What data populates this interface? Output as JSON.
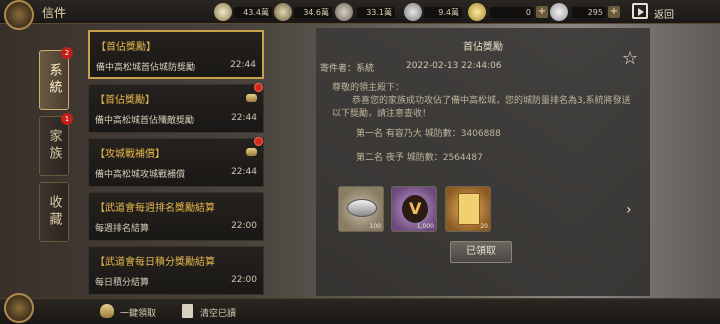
{
  "topbar": {
    "title": "信件",
    "resources": [
      {
        "icon": "gold-coin-icon",
        "value": "43.4萬"
      },
      {
        "icon": "wheat-icon",
        "value": "34.6萬"
      },
      {
        "icon": "wood-icon",
        "value": "33.1萬"
      },
      {
        "icon": "stone-icon",
        "value": "9.4萬"
      },
      {
        "icon": "jade-icon",
        "value": "0"
      },
      {
        "icon": "silver-icon",
        "value": "295"
      }
    ],
    "back_label": "返回"
  },
  "tabs": [
    {
      "label": "系統",
      "badge": "2",
      "active": true
    },
    {
      "label": "家族",
      "badge": "1",
      "active": false
    },
    {
      "label": "收藏",
      "badge": "",
      "active": false
    }
  ],
  "mails": [
    {
      "title": "【首佔獎勵】",
      "subtitle": "備中高松城首佔城防獎勵",
      "time": "22:44",
      "attachment": false,
      "unread": false,
      "selected": true
    },
    {
      "title": "【首佔獎勵】",
      "subtitle": "備中高松城首佔殲敵獎勵",
      "time": "22:44",
      "attachment": true,
      "unread": true,
      "selected": false
    },
    {
      "title": "【攻城戰補償】",
      "subtitle": "備中高松城攻城戰補償",
      "time": "22:44",
      "attachment": true,
      "unread": true,
      "selected": false
    },
    {
      "title": "【武道會每週排名獎勵結算",
      "subtitle": "每週排名結算",
      "time": "22:00",
      "attachment": false,
      "unread": false,
      "selected": false
    },
    {
      "title": "【武道會每日積分獎勵結算",
      "subtitle": "每日積分結算",
      "time": "22:00",
      "attachment": false,
      "unread": false,
      "selected": false
    }
  ],
  "detail": {
    "title": "首佔獎勵",
    "sender": "寄件者：系統",
    "date": "2022-02-13 22:44:06",
    "greeting": "尊敬的領主殿下：",
    "body": "恭喜您的家族成功攻佔了備中高松城，您的城防量排名為3,系統將發送以下獎勵，請注意查收！",
    "rank1": "第一名 有容乃大 城防數：3406888",
    "rank2": "第二名 夜予 城防數：2564487",
    "rewards": [
      {
        "icon": "coin-pile-icon",
        "count": "100"
      },
      {
        "icon": "clan-flag-icon",
        "count": "1,000"
      },
      {
        "icon": "scroll-bundle-icon",
        "count": "20"
      }
    ],
    "claimed_label": "已領取"
  },
  "bottom": {
    "claim_all_label": "一鍵領取",
    "clear_claimed_label": "清空已讀"
  }
}
